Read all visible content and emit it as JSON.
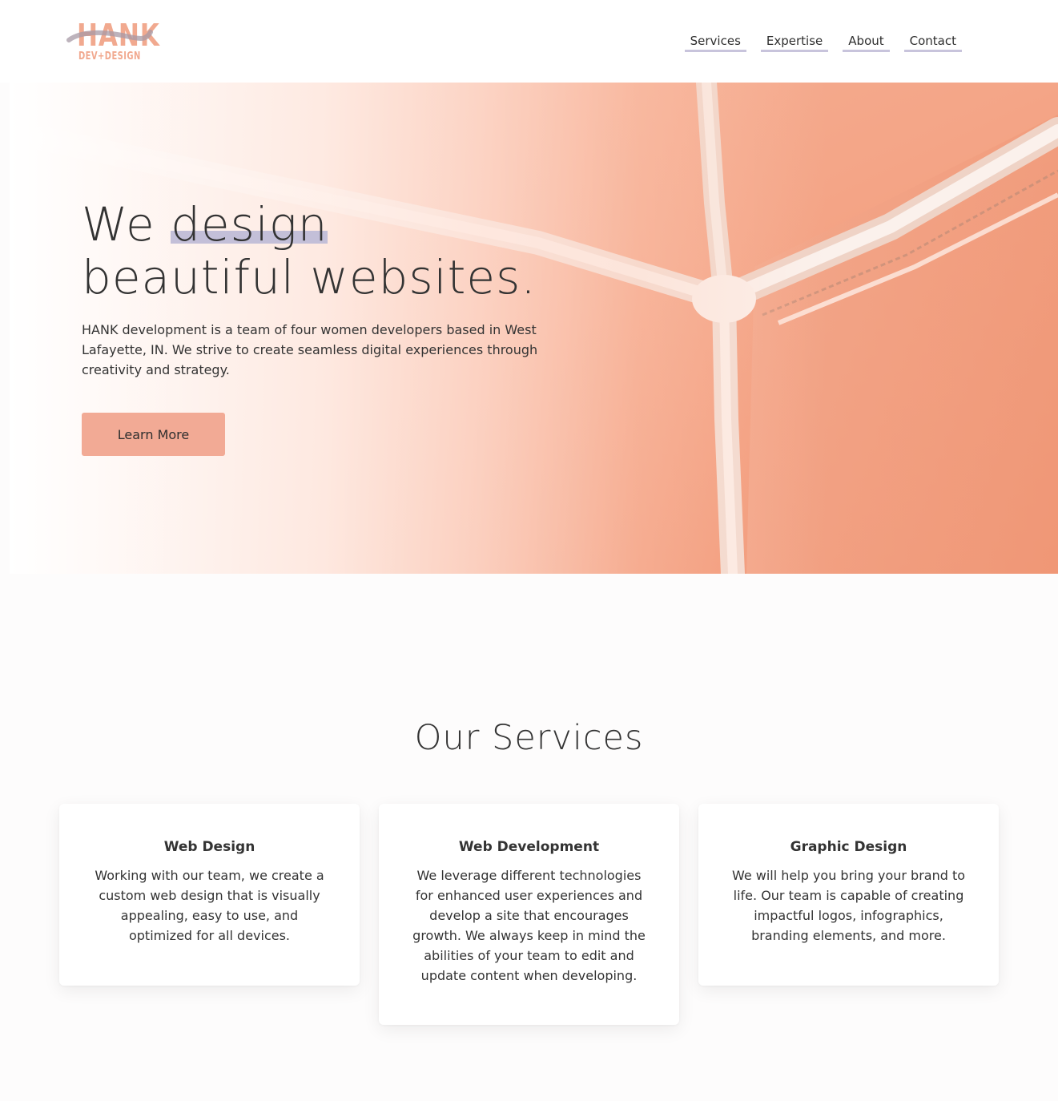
{
  "logo": {
    "main": "HANK",
    "sub": "DEV+DESIGN"
  },
  "nav": {
    "items": [
      {
        "label": "Services"
      },
      {
        "label": "Expertise"
      },
      {
        "label": "About"
      },
      {
        "label": "Contact"
      }
    ]
  },
  "hero": {
    "title_prefix": "We",
    "title_highlight": "design",
    "title_line2": "beautiful websites.",
    "description": "HANK development is a team of four women developers based in West Lafayette, IN. We strive to create seamless digital experiences through creativity and strategy.",
    "button_label": "Learn More"
  },
  "services": {
    "title": "Our Services",
    "cards": [
      {
        "title": "Web Design",
        "text": "Working with our team, we create a custom web design that is visually appealing, easy to use, and optimized for all devices."
      },
      {
        "title": "Web Development",
        "text": "We leverage different technologies for enhanced user experiences and develop a site that encourages growth. We always keep in mind the abilities of your team to edit and update content when developing."
      },
      {
        "title": "Graphic Design",
        "text": "We will help you bring your brand to life. Our team is capable of creating impactful logos, infographics, branding elements, and more."
      }
    ]
  },
  "colors": {
    "accent": "#f2aa95",
    "highlight": "#c3bfd8",
    "logo": "#f1a98f"
  }
}
